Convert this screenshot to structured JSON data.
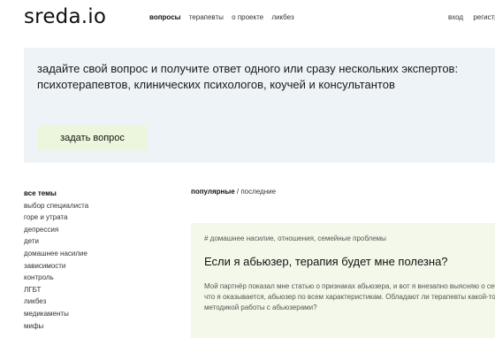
{
  "header": {
    "logo": "sreda.io",
    "nav": [
      "вопросы",
      "терапевты",
      "о проекте",
      "ликбез"
    ],
    "auth": [
      "вход",
      "регистрация"
    ]
  },
  "hero": {
    "text": "задайте свой вопрос и получите ответ одного или сразу нескольких экспертов: психотерапевтов, клинических психологов, коучей и консультантов",
    "button": "задать вопрос"
  },
  "sidebar": {
    "items": [
      "все темы",
      "выбор специалиста",
      "горе и утрата",
      "депрессия",
      "дети",
      "домашнее насилие",
      "зависимости",
      "контроль",
      "ЛГБТ",
      "ликбез",
      "медикаменты",
      "мифы"
    ]
  },
  "sort": {
    "popular": "популярные",
    "separator": " / ",
    "latest": "последние"
  },
  "card": {
    "tags": "# домашнее насилие, отношения, семейные проблемы",
    "title": "Если я абьюзер, терапия будет мне полезна?",
    "excerpt": "Мой партнёр показал мне статью о признаках абьюзера, и вот я внезапно выясняю о себе, что я оказывается, абьюзер по всем характеристикам. Обладают ли терапевты какой-то методикой работы с абьюзерами?"
  }
}
